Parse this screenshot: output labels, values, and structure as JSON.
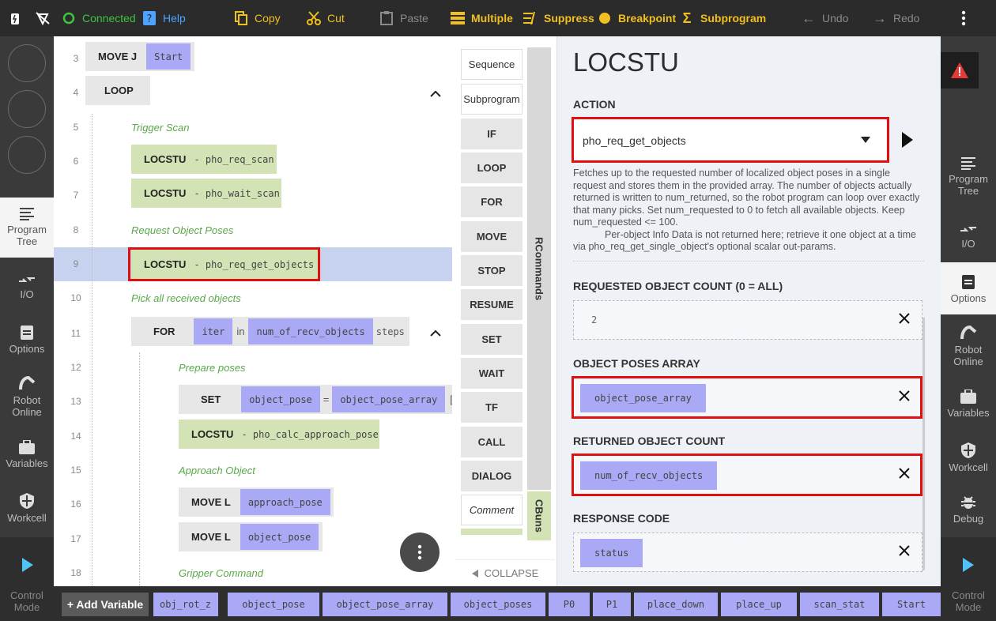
{
  "topbar": {
    "connected": "Connected",
    "help": "Help",
    "copy": "Copy",
    "cut": "Cut",
    "paste": "Paste",
    "multiple": "Multiple",
    "suppress": "Suppress",
    "breakpoint": "Breakpoint",
    "subprogram": "Subprogram",
    "undo": "Undo",
    "redo": "Redo"
  },
  "leftrail": {
    "program_tree": "Program Tree",
    "io": "I/O",
    "options": "Options",
    "robot_online": "Robot Online",
    "variables": "Variables",
    "workcell": "Workcell",
    "control_mode": "Control Mode"
  },
  "tree": {
    "rows": [
      {
        "n": "3",
        "kw": "MOVE J",
        "var": "Start"
      },
      {
        "n": "4",
        "kw": "LOOP"
      },
      {
        "n": "5",
        "comment": "Trigger Scan"
      },
      {
        "n": "6",
        "kw": "LOCSTU",
        "suffix": "- pho_req_scan"
      },
      {
        "n": "7",
        "kw": "LOCSTU",
        "suffix": "- pho_wait_scan"
      },
      {
        "n": "8",
        "comment": "Request Object Poses"
      },
      {
        "n": "9",
        "kw": "LOCSTU",
        "suffix": "- pho_req_get_objects"
      },
      {
        "n": "10",
        "comment": "Pick all received objects"
      },
      {
        "n": "11",
        "kw": "FOR",
        "var1": "iter",
        "mid": "in",
        "var2": "num_of_recv_objects",
        "tail": "steps"
      },
      {
        "n": "12",
        "comment": "Prepare poses"
      },
      {
        "n": "13",
        "kw": "SET",
        "var1": "object_pose",
        "mid": "=",
        "var2": "object_pose_array",
        "tail": "["
      },
      {
        "n": "14",
        "kw": "LOCSTU",
        "suffix": "- pho_calc_approach_pose"
      },
      {
        "n": "15",
        "comment": "Approach Object"
      },
      {
        "n": "16",
        "kw": "MOVE L",
        "var": "approach_pose"
      },
      {
        "n": "17",
        "kw": "MOVE L",
        "var": "object_pose"
      },
      {
        "n": "18",
        "comment": "Gripper Command"
      }
    ]
  },
  "commands": {
    "items": [
      "Sequence",
      "Subprogram",
      "IF",
      "LOOP",
      "FOR",
      "MOVE",
      "STOP",
      "RESUME",
      "SET",
      "WAIT",
      "TF",
      "CALL",
      "DIALOG",
      "Comment"
    ],
    "rcommands": "RCommands",
    "cbuns": "CBuns",
    "collapse": "COLLAPSE"
  },
  "panel": {
    "title": "LOCSTU",
    "action_label": "ACTION",
    "action_value": "pho_req_get_objects",
    "description_p1": "Fetches up to the requested number of localized object poses in a single request and stores them in the provided array. The number of objects actually returned is written to num_returned, so the robot program can loop over exactly that many picks. Set num_requested to 0 to fetch all available objects. Keep num_requested <= 100.",
    "description_p2": "Per-object Info Data is not returned here; retrieve it one object at a time via pho_req_get_single_object's optional scalar out-params.",
    "req_count_label": "REQUESTED OBJECT COUNT (0 = ALL)",
    "req_count_value": "2",
    "poses_label": "OBJECT POSES ARRAY",
    "poses_value": "object_pose_array",
    "returned_label": "RETURNED OBJECT COUNT",
    "returned_value": "num_of_recv_objects",
    "response_label": "RESPONSE CODE",
    "response_value": "status"
  },
  "rightrail": {
    "program_tree": "Program Tree",
    "io": "I/O",
    "options": "Options",
    "robot_online": "Robot Online",
    "variables": "Variables",
    "workcell": "Workcell",
    "debug": "Debug",
    "control_mode": "Control Mode"
  },
  "bottombar": {
    "add_variable": "+ Add Variable",
    "chips": [
      "obj_rot_z",
      "object_pose",
      "object_pose_array",
      "object_poses",
      "P0",
      "P1",
      "place_down",
      "place_up",
      "scan_stat",
      "Start"
    ]
  },
  "colors": {
    "accent": "#f0c020",
    "connected": "#3ec43e",
    "highlight_red": "#e01010",
    "var_chip": "#a9a9f5",
    "locstu_block": "#d3e3b5"
  }
}
